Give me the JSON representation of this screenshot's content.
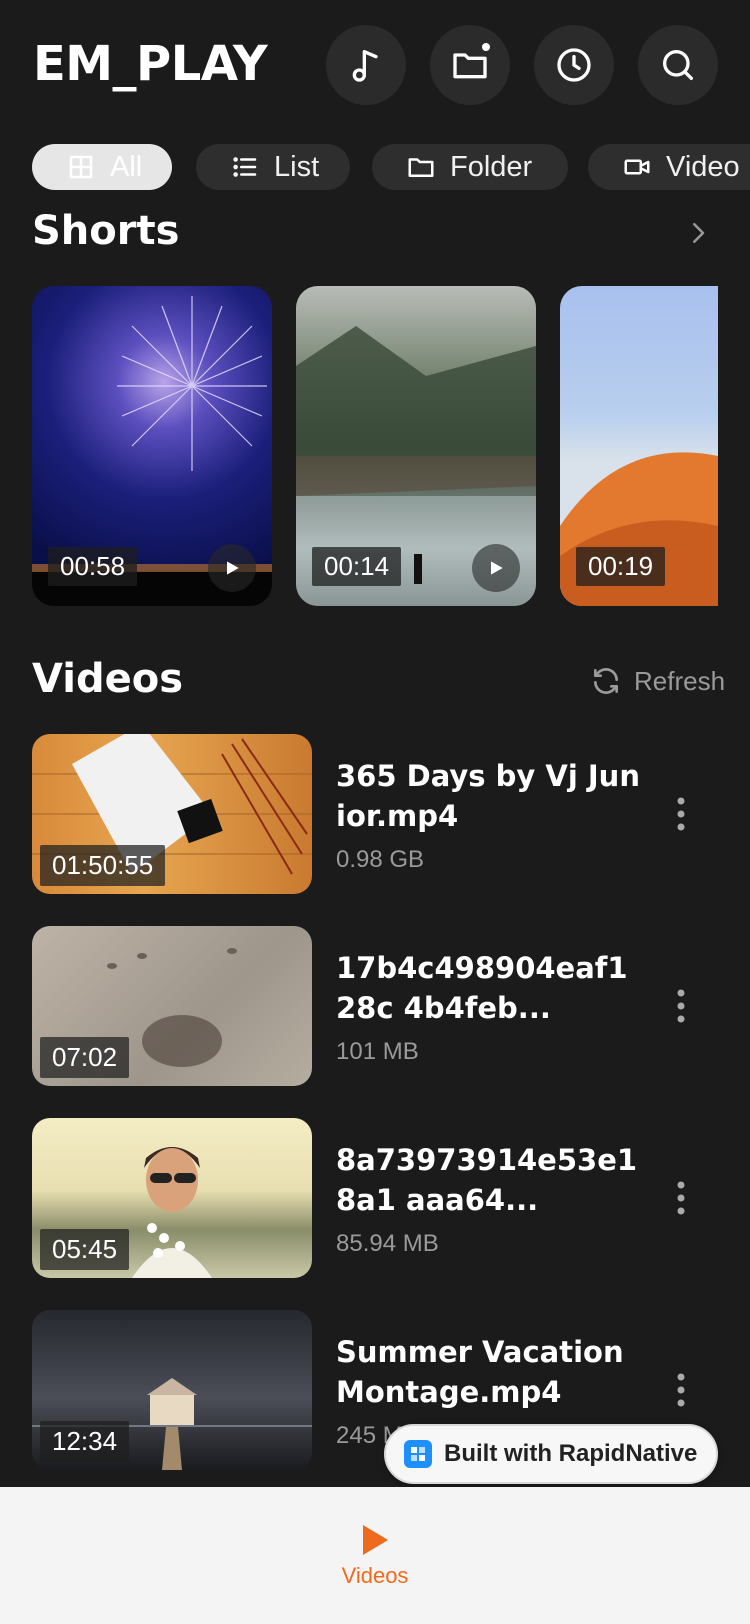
{
  "header": {
    "title": "EM_PLAY"
  },
  "chips": [
    {
      "label": "All",
      "icon": "grid-icon"
    },
    {
      "label": "List",
      "icon": "list-icon"
    },
    {
      "label": "Folder",
      "icon": "folder-icon"
    },
    {
      "label": "Video",
      "icon": "video-icon"
    }
  ],
  "shorts": {
    "title": "Shorts",
    "items": [
      {
        "duration": "00:58"
      },
      {
        "duration": "00:14"
      },
      {
        "duration": "00:19"
      }
    ]
  },
  "videos": {
    "title": "Videos",
    "refresh_label": "Refresh",
    "items": [
      {
        "title": "365 Days by Vj Junior.mp4",
        "size": "0.98 GB",
        "duration": "01:50:55"
      },
      {
        "title": "17b4c498904eaf128c 4b4feb...",
        "size": "101 MB",
        "duration": "07:02"
      },
      {
        "title": "8a73973914e53e18a1 aaa64...",
        "size": "85.94 MB",
        "duration": "05:45"
      },
      {
        "title": "Summer Vacation Montage.mp4",
        "size": "245 MB",
        "duration": "12:34"
      }
    ]
  },
  "badge": {
    "label": "Built with RapidNative"
  },
  "tabbar": {
    "videos_label": "Videos"
  },
  "colors": {
    "accent": "#f06a1d",
    "background": "#1b1b1c"
  }
}
